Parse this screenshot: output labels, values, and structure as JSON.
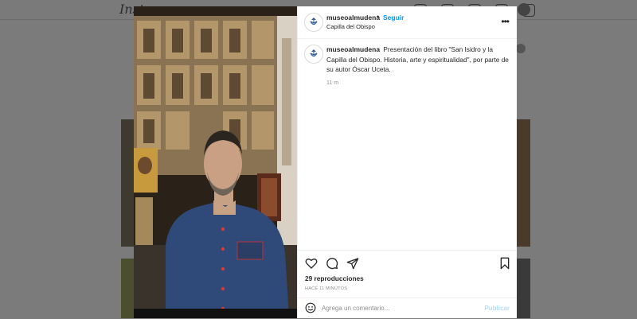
{
  "background": {
    "logo": "Inst"
  },
  "post": {
    "header": {
      "username": "museoalmudena",
      "separator": "•",
      "follow_label": "Seguir",
      "location": "Capilla del Obispo",
      "more_icon": "more-horizontal-icon"
    },
    "caption": {
      "username": "museoalmudena",
      "text": "Presentación del libro \"San Isidro y la Capilla del Obispo. Historia, arte y espiritualidad\", por parte de su autor Óscar Uceta.",
      "time": "11 m"
    },
    "actions": {
      "icons": [
        "heart-icon",
        "comment-icon",
        "share-icon",
        "bookmark-icon"
      ],
      "views": "29 reproducciones",
      "ago": "HACE 11 MINUTOS"
    },
    "comment": {
      "placeholder": "Agrega un comentario...",
      "publish_label": "Publicar"
    }
  },
  "colors": {
    "link": "#0095f6",
    "publish_disabled": "#b2dffc",
    "text": "#262626",
    "muted": "#8e8e8e"
  }
}
